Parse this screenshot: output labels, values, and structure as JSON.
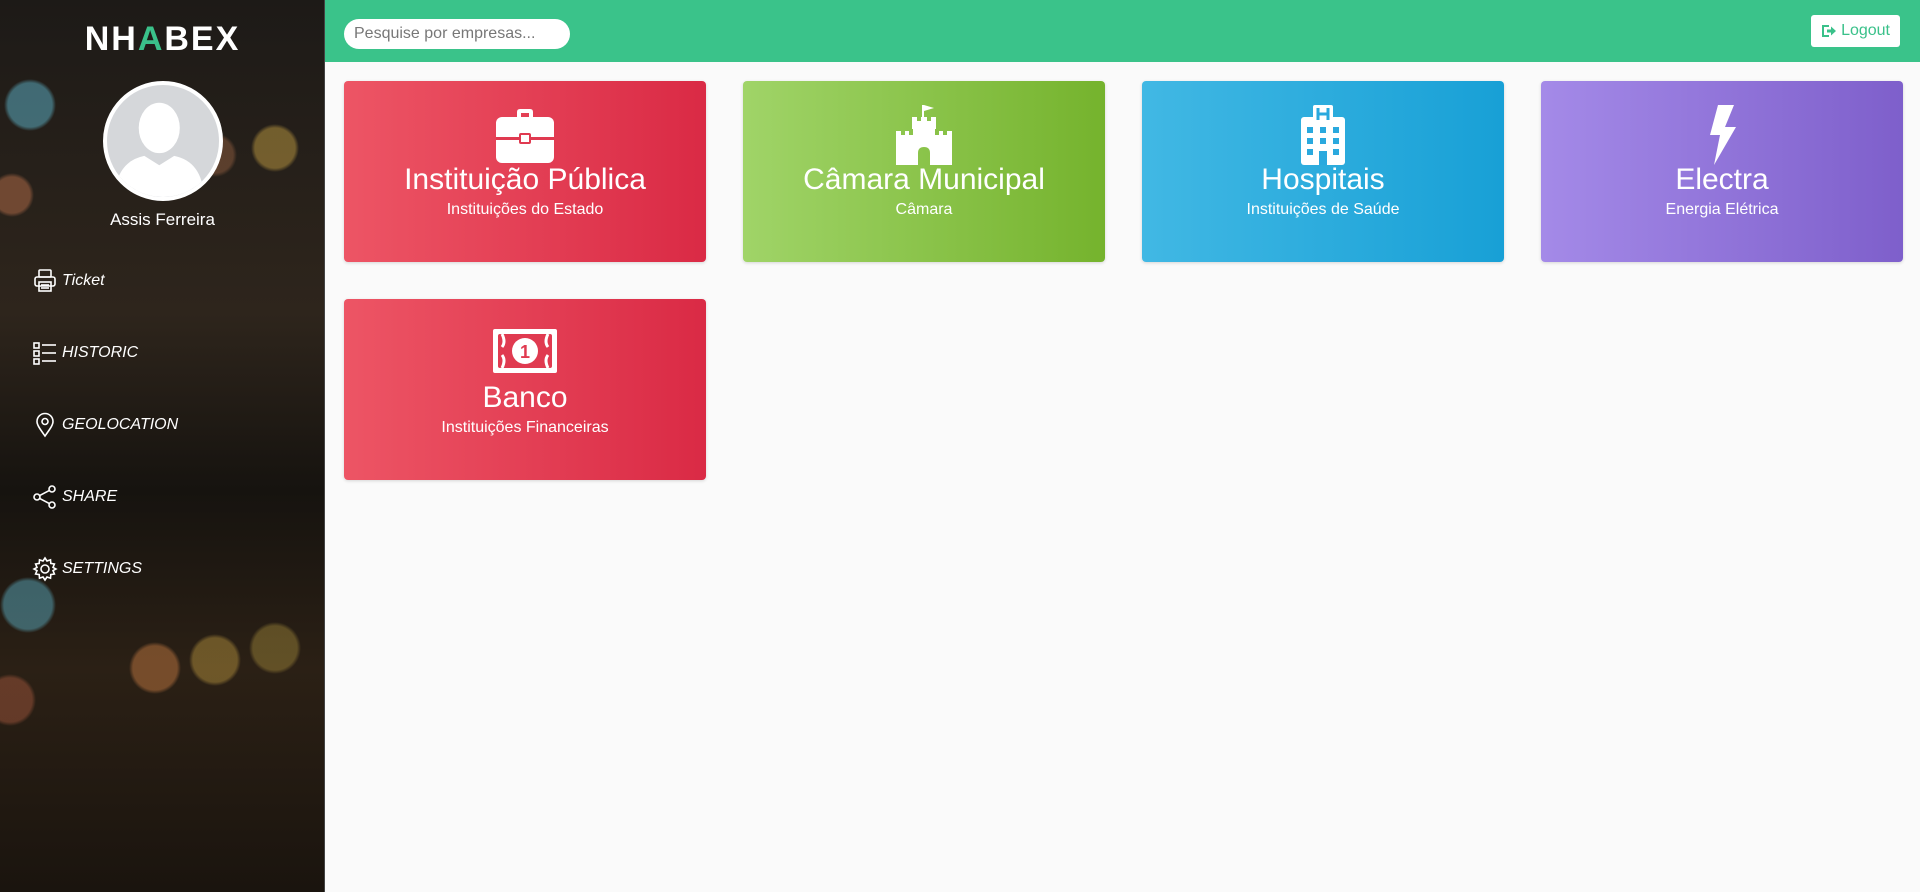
{
  "brand": {
    "logo_pre": "NH",
    "logo_mid": "A",
    "logo_post": "BEX"
  },
  "user": {
    "name": "Assis Ferreira"
  },
  "menu": [
    {
      "label": "Ticket",
      "icon": "printer-icon"
    },
    {
      "label": "HISTORIC",
      "icon": "list-icon"
    },
    {
      "label": "GEOLOCATION",
      "icon": "map-pin-icon"
    },
    {
      "label": "SHARE",
      "icon": "share-icon"
    },
    {
      "label": "SETTINGS",
      "icon": "gear-icon"
    }
  ],
  "search": {
    "placeholder": "Pesquise por empresas..."
  },
  "header": {
    "logout_label": "Logout"
  },
  "cards": [
    {
      "title": "Instituição Pública",
      "subtitle": "Instituições do Estado",
      "icon": "briefcase-icon",
      "color": "#da2a45"
    },
    {
      "title": "Câmara Municipal",
      "subtitle": "Câmara",
      "icon": "castle-icon",
      "color": "#75b32d"
    },
    {
      "title": "Hospitais",
      "subtitle": "Instituições de Saúde",
      "icon": "hospital-icon",
      "color": "#18a0d6"
    },
    {
      "title": "Electra",
      "subtitle": "Energia Elétrica",
      "icon": "lightning-icon",
      "color": "#7e5fcb"
    },
    {
      "title": "Banco",
      "subtitle": "Instituições Financeiras",
      "icon": "money-icon",
      "color": "#da2a45"
    }
  ],
  "colors": {
    "accent": "#3ac38a"
  }
}
